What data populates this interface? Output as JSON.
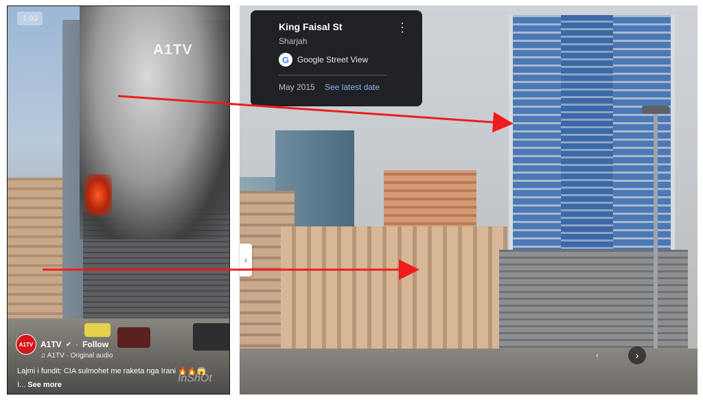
{
  "reel": {
    "speed_badge": "1.00",
    "watermark": "A1TV",
    "inshot_watermark": "InShOt",
    "channel": {
      "avatar_text": "A1TV",
      "name": "A1TV",
      "dot": "·",
      "follow": "Follow"
    },
    "audio": "♫ A1TV · Original audio",
    "caption": "Lajmi i fundit: CIA sulmohet me raketa nga Irani 🔥🔥😱",
    "see_more_prefix": "I...",
    "see_more": "See more"
  },
  "street_view": {
    "place_title": "King Faisal St",
    "place_subtitle": "Sharjah",
    "provider_label": "Google Street View",
    "capture_date": "May 2015",
    "latest_date_link": "See latest date",
    "icons": {
      "more": "more-vert-icon",
      "google": "google-logo-icon",
      "next": "chevron-right-icon",
      "collapse": "chevron-right-icon"
    }
  },
  "annotation": {
    "arrow_color": "#ee1c1c"
  }
}
